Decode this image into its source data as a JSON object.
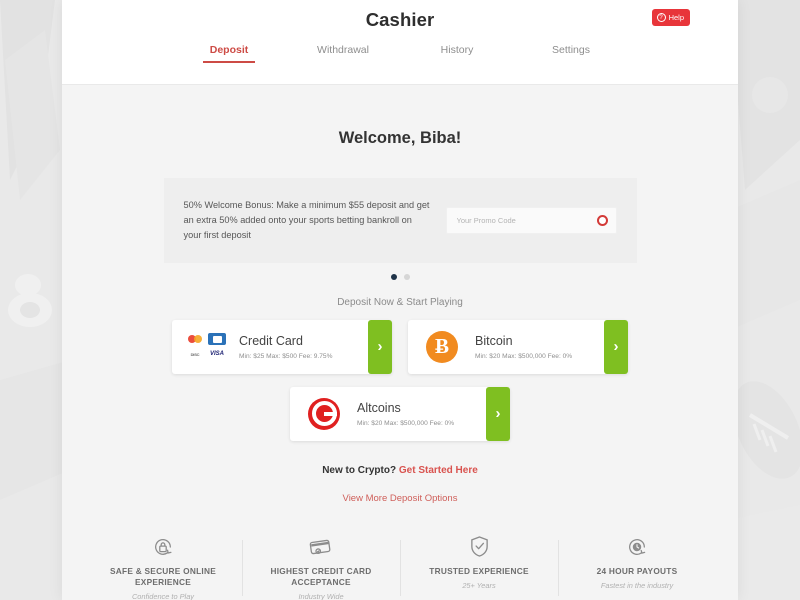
{
  "header": {
    "title": "Cashier",
    "help_label": "Help",
    "help_icon": "help-circle-icon"
  },
  "tabs": [
    {
      "label": "Deposit",
      "active": true
    },
    {
      "label": "Withdrawal",
      "active": false
    },
    {
      "label": "History",
      "active": false
    },
    {
      "label": "Settings",
      "active": false
    }
  ],
  "welcome": "Welcome, Biba!",
  "promo": {
    "text": "50% Welcome Bonus: Make a minimum $55 deposit and get an extra 50% added onto your sports betting bankroll on your first deposit",
    "placeholder": "Your Promo Code",
    "value": "",
    "submit_icon": "circle-arrow-icon"
  },
  "carousel": {
    "slides": 2,
    "active_index": 0
  },
  "deposit": {
    "heading": "Deposit Now & Start Playing",
    "methods": [
      {
        "name": "Credit Card",
        "limits": "Min: $25  Max: $500  Fee: 9.75%",
        "logo": "credit-card-brands-icon",
        "brands": [
          "MASTERCARD",
          "AMEX",
          "DISCOVER",
          "VISA"
        ],
        "arrow": "›"
      },
      {
        "name": "Bitcoin",
        "limits": "Min: $20  Max: $500,000  Fee: 0%",
        "logo": "bitcoin-icon",
        "symbol": "Ƀ",
        "arrow": "›"
      },
      {
        "name": "Altcoins",
        "limits": "Min: $20  Max: $500,000  Fee: 0%",
        "logo": "altcoins-icon",
        "arrow": "›"
      }
    ]
  },
  "crypto_cta": {
    "prefix": "New to Crypto? ",
    "link": "Get Started Here"
  },
  "more_options": "View More Deposit Options",
  "badges": [
    {
      "icon": "lock-shield-icon",
      "title": "SAFE & SECURE ONLINE EXPERIENCE",
      "sub": "Confidence to Play"
    },
    {
      "icon": "credit-card-icon",
      "title": "HIGHEST CREDIT CARD ACCEPTANCE",
      "sub": "Industry Wide"
    },
    {
      "icon": "shield-check-icon",
      "title": "TRUSTED EXPERIENCE",
      "sub": "25+ Years"
    },
    {
      "icon": "clock-icon",
      "title": "24 HOUR PAYOUTS",
      "sub": "Fastest in the industry"
    }
  ],
  "colors": {
    "accent_red": "#cd4b45",
    "help_red": "#e8353a",
    "green_arrow": "#7fbf21",
    "bitcoin_orange": "#f18b20",
    "altcoin_red": "#e02020",
    "panel_bg": "#f4f4f4"
  }
}
